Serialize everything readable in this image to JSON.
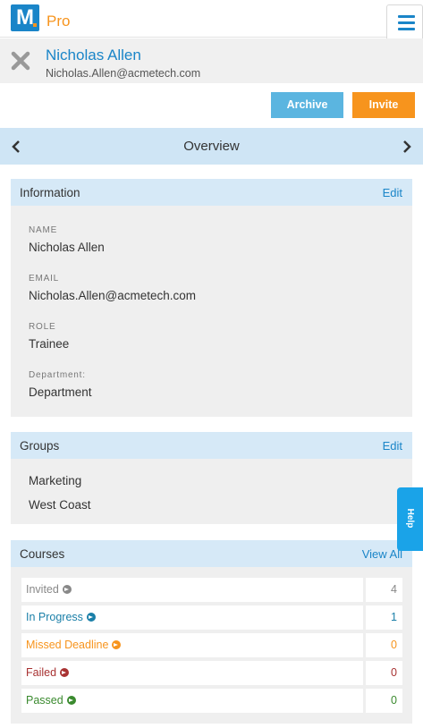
{
  "header": {
    "logo_letter": "M",
    "logo_suffix": "Pro",
    "menu_icon": "hamburger-icon"
  },
  "profile": {
    "name": "Nicholas Allen",
    "email": "Nicholas.Allen@acmetech.com",
    "close_icon": "close-icon"
  },
  "actions": {
    "archive_label": "Archive",
    "invite_label": "Invite"
  },
  "overview": {
    "title": "Overview",
    "prev_icon": "chevron-left-icon",
    "next_icon": "chevron-right-icon"
  },
  "information": {
    "title": "Information",
    "edit_label": "Edit",
    "fields": [
      {
        "label": "NAME",
        "value": "Nicholas Allen"
      },
      {
        "label": "EMAIL",
        "value": "Nicholas.Allen@acmetech.com"
      },
      {
        "label": "ROLE",
        "value": "Trainee"
      },
      {
        "label": "Department:",
        "value": "Department"
      }
    ]
  },
  "groups": {
    "title": "Groups",
    "edit_label": "Edit",
    "items": [
      "Marketing",
      "West Coast"
    ]
  },
  "courses": {
    "title": "Courses",
    "view_all_label": "View All",
    "rows": [
      {
        "label": "Invited",
        "count": "4",
        "color": "#888888"
      },
      {
        "label": "In Progress",
        "count": "1",
        "color": "#1a7fa8"
      },
      {
        "label": "Missed Deadline",
        "count": "0",
        "color": "#f7941d"
      },
      {
        "label": "Failed",
        "count": "0",
        "color": "#a83232"
      },
      {
        "label": "Passed",
        "count": "0",
        "color": "#3a8a2e"
      }
    ]
  },
  "help": {
    "label": "Help"
  },
  "colors": {
    "brand_blue": "#1a85c8",
    "brand_orange": "#f7941d",
    "panel_header": "#d6e9f7",
    "archive_button": "#5bb5e0",
    "help_tab": "#1aa3e8"
  }
}
